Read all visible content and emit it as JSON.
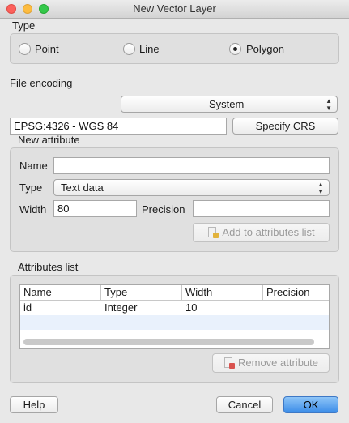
{
  "window": {
    "title": "New Vector Layer"
  },
  "type_group": {
    "title": "Type",
    "options": [
      {
        "label": "Point",
        "checked": false
      },
      {
        "label": "Line",
        "checked": false
      },
      {
        "label": "Polygon",
        "checked": true
      }
    ]
  },
  "file_encoding": {
    "label": "File encoding",
    "value": "System"
  },
  "crs": {
    "value": "EPSG:4326 - WGS 84",
    "button": "Specify CRS"
  },
  "new_attribute": {
    "title": "New attribute",
    "name_label": "Name",
    "name_value": "",
    "type_label": "Type",
    "type_value": "Text data",
    "width_label": "Width",
    "width_value": "80",
    "precision_label": "Precision",
    "precision_value": "",
    "add_button": "Add to attributes list"
  },
  "attributes_list": {
    "title": "Attributes list",
    "columns": [
      "Name",
      "Type",
      "Width",
      "Precision"
    ],
    "rows": [
      {
        "name": "id",
        "type": "Integer",
        "width": "10",
        "precision": ""
      }
    ],
    "remove_button": "Remove attribute"
  },
  "footer": {
    "help": "Help",
    "cancel": "Cancel",
    "ok": "OK"
  },
  "colors": {
    "default_button": "#3c8de8",
    "selection_row": "#e9f1fc"
  }
}
